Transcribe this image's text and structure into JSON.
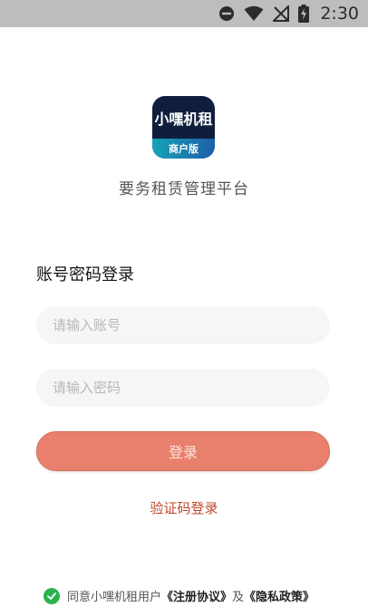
{
  "status_bar": {
    "time": "2:30",
    "icons": [
      "do-not-disturb-icon",
      "wifi-icon",
      "no-signal-icon",
      "battery-charging-icon"
    ]
  },
  "logo": {
    "main_text": "小嘿机租",
    "badge_text": "商户版"
  },
  "tagline": "要务租赁管理平台",
  "login": {
    "section_title": "账号密码登录",
    "account_placeholder": "请输入账号",
    "password_placeholder": "请输入密码",
    "login_button": "登录",
    "sms_login_link": "验证码登录"
  },
  "agreement": {
    "prefix": "同意小嘿机租用户",
    "register_agreement": "《注册协议》",
    "and": "及",
    "privacy_policy": "《隐私政策》"
  },
  "colors": {
    "accent": "#e9806e",
    "link": "#bf4a2a",
    "check": "#2bb24c"
  }
}
